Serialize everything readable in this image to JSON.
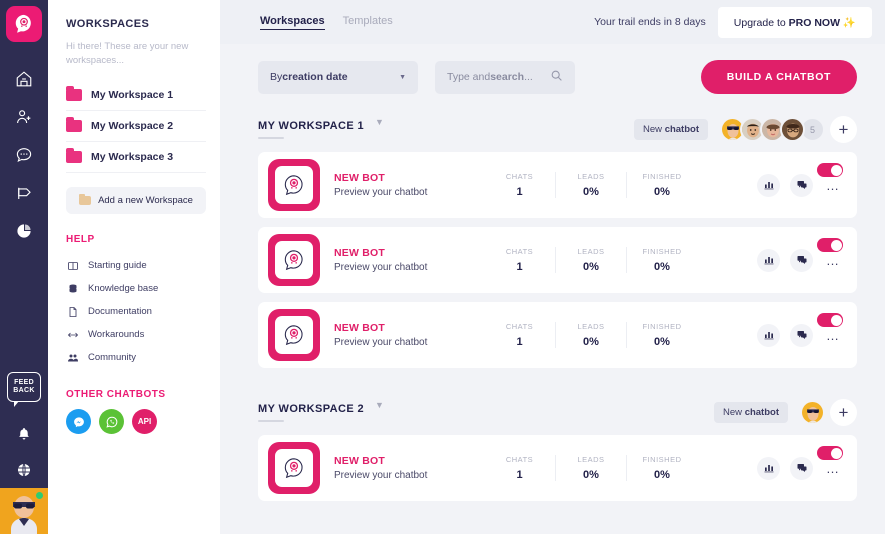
{
  "rail": {
    "logo_name": "chatbot-logo",
    "icons": [
      {
        "name": "home-icon"
      },
      {
        "name": "add-user-icon"
      },
      {
        "name": "chat-bubble-icon"
      },
      {
        "name": "megaphone-icon"
      },
      {
        "name": "pie-chart-icon"
      }
    ],
    "feedback_line1": "FEED",
    "feedback_line2": "BACK",
    "bell_name": "bell-icon",
    "globe_name": "globe-icon"
  },
  "panel": {
    "title": "WORKSPACES",
    "subtitle": "Hi there! These are your new workspaces...",
    "workspaces": [
      {
        "label": "My Workspace 1"
      },
      {
        "label": "My Workspace 2"
      },
      {
        "label": "My Workspace 3"
      }
    ],
    "add_workspace": "Add a new Workspace",
    "help_title": "HELP",
    "help_items": [
      {
        "label": "Starting guide",
        "icon": "book-icon",
        "glyph": "☐"
      },
      {
        "label": "Knowledge base",
        "icon": "database-icon",
        "glyph": "☰"
      },
      {
        "label": "Documentation",
        "icon": "document-icon",
        "glyph": "⎕"
      },
      {
        "label": "Workarounds",
        "icon": "workaround-icon",
        "glyph": "↔"
      },
      {
        "label": "Community",
        "icon": "community-icon",
        "glyph": "☺"
      }
    ],
    "other_title": "OTHER CHATBOTS",
    "channels": [
      {
        "name": "messenger-icon",
        "label": "",
        "color": "#1b9df0"
      },
      {
        "name": "whatsapp-icon",
        "label": "",
        "color": "#5bc236"
      },
      {
        "name": "api-icon",
        "label": "API",
        "color": "#e01f69"
      }
    ]
  },
  "topbar": {
    "tabs": [
      {
        "label": "Workspaces",
        "active": true
      },
      {
        "label": "Templates",
        "active": false
      }
    ],
    "trial_text": "Your trail ends in 8 days",
    "upgrade_prefix": "Upgrade to ",
    "upgrade_strong": "PRO NOW",
    "upgrade_sparkle": "✨"
  },
  "toolbar": {
    "sort_prefix": "By ",
    "sort_value": "creation date",
    "search_prefix": "Type and ",
    "search_strong": "search",
    "search_suffix": "...",
    "build_label": "BUILD A CHATBOT"
  },
  "workspaces": [
    {
      "title": "MY WORKSPACE 1",
      "new_chip_prefix": "New ",
      "new_chip_strong": "chatbot",
      "avatar_count": "5",
      "avatars": [
        "#f3b229",
        "#c9a07a",
        "#caa48b",
        "#7c5b44"
      ],
      "bots": [
        {
          "name": "NEW BOT",
          "subtitle": "Preview your chatbot",
          "stats": [
            {
              "label": "CHATS",
              "value": "1"
            },
            {
              "label": "LEADS",
              "value": "0%"
            },
            {
              "label": "FINISHED",
              "value": "0%"
            }
          ],
          "enabled": true
        },
        {
          "name": "NEW BOT",
          "subtitle": "Preview your chatbot",
          "stats": [
            {
              "label": "CHATS",
              "value": "1"
            },
            {
              "label": "LEADS",
              "value": "0%"
            },
            {
              "label": "FINISHED",
              "value": "0%"
            }
          ],
          "enabled": true
        },
        {
          "name": "NEW BOT",
          "subtitle": "Preview your chatbot",
          "stats": [
            {
              "label": "CHATS",
              "value": "1"
            },
            {
              "label": "LEADS",
              "value": "0%"
            },
            {
              "label": "FINISHED",
              "value": "0%"
            }
          ],
          "enabled": true
        }
      ]
    },
    {
      "title": "MY WORKSPACE 2",
      "new_chip_prefix": "New ",
      "new_chip_strong": "chatbot",
      "avatar_count": "",
      "avatars": [
        "#f3b229"
      ],
      "bots": [
        {
          "name": "NEW BOT",
          "subtitle": "Preview your chatbot",
          "stats": [
            {
              "label": "CHATS",
              "value": "1"
            },
            {
              "label": "LEADS",
              "value": "0%"
            },
            {
              "label": "FINISHED",
              "value": "0%"
            }
          ],
          "enabled": true
        }
      ]
    }
  ],
  "colors": {
    "brand_pink": "#e01f69",
    "rail_dark": "#2e2d52",
    "bg": "#f2f3f7"
  }
}
